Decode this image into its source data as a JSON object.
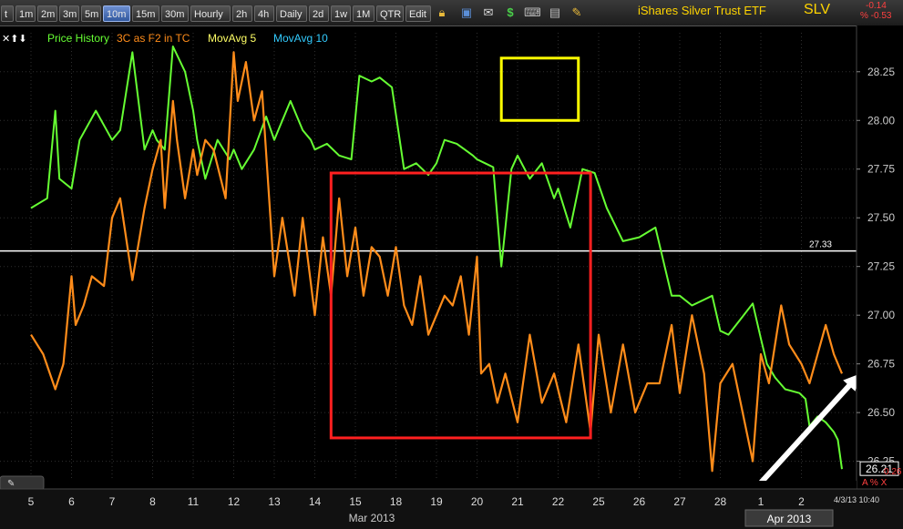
{
  "toolbar": {
    "timeframes": [
      "t",
      "1m",
      "2m",
      "3m",
      "5m",
      "10m",
      "15m",
      "30m",
      "Hourly",
      "2h",
      "4h",
      "Daily",
      "2d",
      "1w",
      "1M",
      "QTR",
      "Edit"
    ],
    "active": "10m",
    "icons": [
      "lock-icon",
      "save-icon",
      "email-icon",
      "dollar-icon",
      "keyboard-icon",
      "pencil-icon"
    ]
  },
  "symbol": {
    "name": "iShares Silver Trust ETF",
    "ticker": "SLV",
    "change": "-0.14",
    "change_pct": "% -0.53"
  },
  "legend": {
    "arrows": "✕⬆⬇",
    "items": [
      {
        "label": "Price History",
        "color": "#66ff33"
      },
      {
        "label": "3C as F2 in TC",
        "color": "#ff8c1a"
      },
      {
        "label": "MovAvg 5",
        "color": "#ffff66"
      },
      {
        "label": "MovAvg 10",
        "color": "#33ccff"
      }
    ]
  },
  "chart_data": {
    "type": "line",
    "ylim": [
      26.15,
      28.45
    ],
    "yticks": [
      "28.25",
      "28.00",
      "27.75",
      "27.50",
      "27.25",
      "27.00",
      "26.75",
      "26.50",
      "26.25"
    ],
    "ytick_values": [
      28.25,
      28.0,
      27.75,
      27.5,
      27.25,
      27.0,
      26.75,
      26.5,
      26.25
    ],
    "x_labels": [
      "5",
      "6",
      "7",
      "8",
      "11",
      "12",
      "13",
      "14",
      "15",
      "18",
      "19",
      "20",
      "21",
      "22",
      "25",
      "26",
      "27",
      "28",
      "1",
      "2"
    ],
    "months": [
      "Mar 2013",
      "Apr 2013"
    ],
    "timestamp": "4/3/13 10:40",
    "hline": {
      "value": 27.33,
      "label": "27.33"
    },
    "last_price": "26.21",
    "lower_value": "0.26",
    "lower_marks": "A %  X",
    "series": [
      {
        "name": "Price History",
        "color": "#66ff33",
        "x": [
          0,
          0.4,
          0.6,
          0.7,
          1,
          1.2,
          1.6,
          2,
          2.2,
          2.5,
          2.8,
          3,
          3.1,
          3.3,
          3.5,
          3.8,
          4,
          4.1,
          4.3,
          4.6,
          4.9,
          5,
          5.2,
          5.5,
          5.8,
          6,
          6.1,
          6.4,
          6.7,
          6.9,
          7,
          7.3,
          7.6,
          7.9,
          8.1,
          8.4,
          8.6,
          8.9,
          9.2,
          9.5,
          9.8,
          10,
          10.2,
          10.5,
          10.9,
          11,
          11.2,
          11.4,
          11.6,
          11.85,
          12,
          12.3,
          12.6,
          12.9,
          13,
          13.3,
          13.6,
          13.9,
          14.2,
          14.6,
          15,
          15.4,
          15.8,
          16,
          16.3,
          16.6,
          16.8,
          17,
          17.2,
          17.5,
          17.8,
          18,
          18.15,
          18.35,
          18.6,
          18.95,
          19.1,
          19.2,
          19.4,
          19.6,
          19.8,
          19.9,
          20
        ],
        "y": [
          27.55,
          27.6,
          28.05,
          27.7,
          27.65,
          27.9,
          28.05,
          27.9,
          27.95,
          28.35,
          27.85,
          27.95,
          27.9,
          27.85,
          28.38,
          28.25,
          28.05,
          27.9,
          27.7,
          27.9,
          27.8,
          27.85,
          27.75,
          27.85,
          28.02,
          27.9,
          27.95,
          28.1,
          27.95,
          27.9,
          27.85,
          27.88,
          27.82,
          27.8,
          28.23,
          28.2,
          28.22,
          28.17,
          27.75,
          27.78,
          27.72,
          27.78,
          27.9,
          27.88,
          27.82,
          27.8,
          27.78,
          27.76,
          27.25,
          27.75,
          27.82,
          27.7,
          27.78,
          27.6,
          27.65,
          27.45,
          27.75,
          27.73,
          27.55,
          27.38,
          27.4,
          27.45,
          27.1,
          27.1,
          27.05,
          27.08,
          27.1,
          26.92,
          26.9,
          26.98,
          27.06,
          26.88,
          26.75,
          26.68,
          26.62,
          26.6,
          26.57,
          26.43,
          26.48,
          26.45,
          26.4,
          26.36,
          26.21
        ]
      },
      {
        "name": "3C as F2 in TC",
        "color": "#ff8c1a",
        "x": [
          0,
          0.3,
          0.6,
          0.8,
          1,
          1.1,
          1.3,
          1.5,
          1.8,
          2,
          2.2,
          2.5,
          2.8,
          3,
          3.2,
          3.3,
          3.5,
          3.6,
          3.8,
          4,
          4.1,
          4.3,
          4.5,
          4.8,
          5,
          5.1,
          5.3,
          5.5,
          5.7,
          6,
          6.2,
          6.5,
          6.7,
          7,
          7.2,
          7.4,
          7.6,
          7.8,
          8,
          8.2,
          8.4,
          8.6,
          8.8,
          9,
          9.2,
          9.4,
          9.6,
          9.8,
          10,
          10.2,
          10.4,
          10.6,
          10.8,
          11,
          11.1,
          11.3,
          11.5,
          11.7,
          12,
          12.3,
          12.6,
          12.9,
          13.2,
          13.5,
          13.8,
          14,
          14.3,
          14.6,
          14.9,
          15.2,
          15.5,
          15.8,
          16,
          16.3,
          16.6,
          16.8,
          17,
          17.3,
          17.5,
          17.8,
          18,
          18.2,
          18.5,
          18.7,
          19,
          19.2,
          19.4,
          19.6,
          19.8,
          20
        ],
        "y": [
          26.9,
          26.8,
          26.62,
          26.75,
          27.2,
          26.95,
          27.05,
          27.2,
          27.15,
          27.5,
          27.6,
          27.18,
          27.55,
          27.75,
          27.9,
          27.55,
          28.1,
          27.9,
          27.6,
          27.85,
          27.72,
          27.9,
          27.85,
          27.6,
          28.35,
          28.1,
          28.3,
          28.0,
          28.15,
          27.2,
          27.5,
          27.1,
          27.5,
          27.0,
          27.4,
          27.1,
          27.6,
          27.2,
          27.45,
          27.1,
          27.35,
          27.3,
          27.1,
          27.35,
          27.05,
          26.95,
          27.2,
          26.9,
          27.0,
          27.1,
          27.05,
          27.2,
          26.9,
          27.3,
          26.7,
          26.75,
          26.55,
          26.7,
          26.45,
          26.9,
          26.55,
          26.7,
          26.45,
          26.85,
          26.4,
          26.9,
          26.5,
          26.85,
          26.5,
          26.65,
          26.65,
          26.95,
          26.6,
          27.0,
          26.7,
          26.2,
          26.65,
          26.75,
          26.55,
          26.25,
          26.8,
          26.65,
          27.05,
          26.85,
          26.75,
          26.65,
          26.8,
          26.95,
          26.8,
          26.7
        ]
      }
    ],
    "annotations": [
      {
        "type": "rect",
        "color": "#ffff00",
        "x0": 11.6,
        "x1": 13.5,
        "y0": 28.0,
        "y1": 28.32
      },
      {
        "type": "rect",
        "color": "#ff2020",
        "x0": 7.4,
        "x1": 13.8,
        "y0": 26.37,
        "y1": 27.73
      },
      {
        "type": "arrow",
        "color": "#ffffff",
        "x0": 18.0,
        "y0": 26.14,
        "x1": 20.45,
        "y1": 26.7
      }
    ]
  }
}
